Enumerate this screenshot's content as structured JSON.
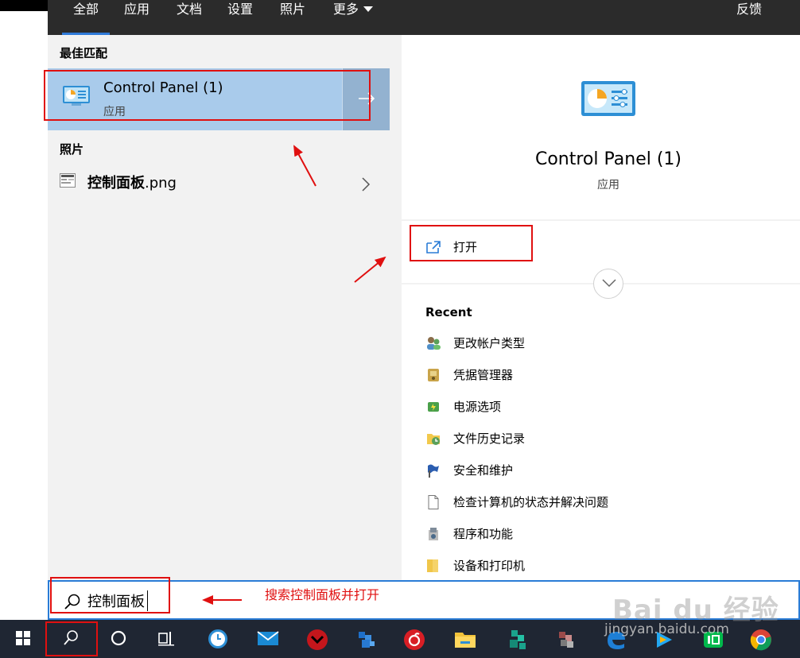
{
  "tabs": [
    {
      "label": "全部",
      "active": true
    },
    {
      "label": "应用"
    },
    {
      "label": "文档"
    },
    {
      "label": "设置"
    },
    {
      "label": "照片"
    },
    {
      "label": "更多"
    }
  ],
  "feedback_label": "反馈",
  "left": {
    "best_match_heading": "最佳匹配",
    "best_match": {
      "title": "Control Panel (1)",
      "subtitle": "应用",
      "icon": "control-panel-icon"
    },
    "photos_heading": "照片",
    "photo_item": {
      "name_bold": "控制面板",
      "name_ext": ".png",
      "icon": "image-file-icon"
    }
  },
  "detail": {
    "title": "Control Panel (1)",
    "subtitle": "应用",
    "open_label": "打开",
    "recent_heading": "Recent",
    "recent_items": [
      {
        "label": "更改帐户类型",
        "icon": "user-accounts-icon"
      },
      {
        "label": "凭据管理器",
        "icon": "credential-manager-icon"
      },
      {
        "label": "电源选项",
        "icon": "power-options-icon"
      },
      {
        "label": "文件历史记录",
        "icon": "file-history-icon"
      },
      {
        "label": "安全和维护",
        "icon": "security-flag-icon"
      },
      {
        "label": "检查计算机的状态并解决问题",
        "icon": "document-icon"
      },
      {
        "label": "程序和功能",
        "icon": "programs-icon"
      },
      {
        "label": "设备和打印机",
        "icon": "folder-icon"
      }
    ]
  },
  "search": {
    "value": "控制面板",
    "icon": "search-icon"
  },
  "annotation_text": "搜索控制面板并打开",
  "watermark": {
    "logo": "Bai du 经验",
    "url": "jingyan.baidu.com"
  },
  "taskbar_icons": [
    "windows-start-icon",
    "search-icon",
    "cortana-icon",
    "task-view-icon",
    "clock-app-icon",
    "mail-icon",
    "red-app-icon",
    "blue-pixel-icon",
    "netease-music-icon",
    "file-explorer-icon",
    "green-pixel-icon",
    "mosaic-app-icon",
    "edge-icon",
    "video-app-icon",
    "iqiyi-icon",
    "chrome-icon"
  ],
  "colors": {
    "accent": "#2f7ad8",
    "selection": "#a9cbeb",
    "annotation": "#e01010",
    "topbar": "#2b2b2b",
    "taskbar": "#1f2633"
  }
}
